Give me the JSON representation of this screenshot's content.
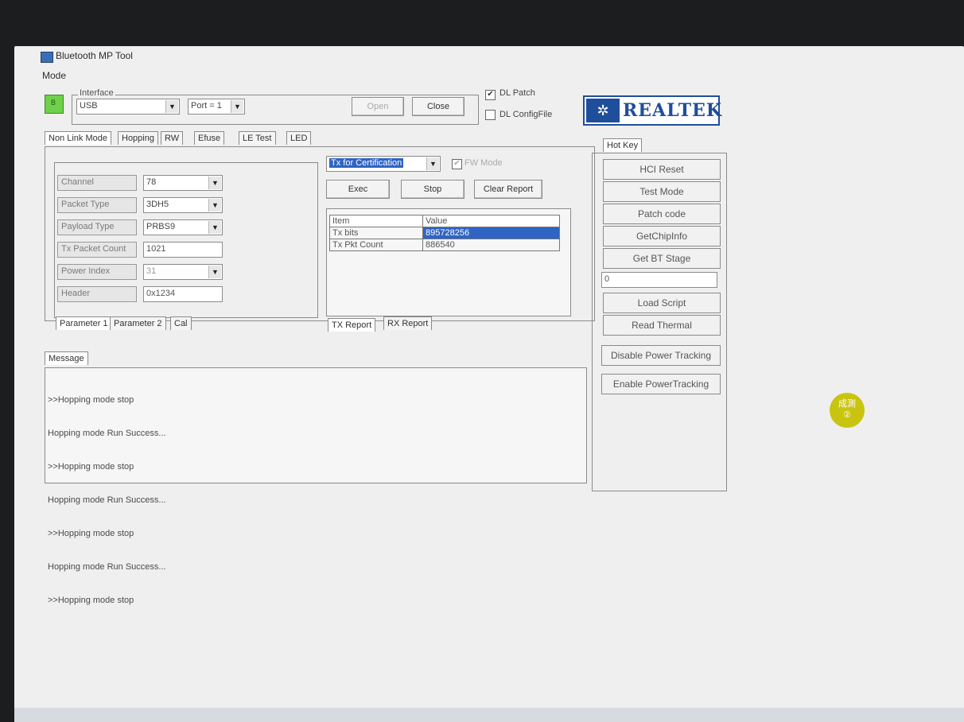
{
  "window": {
    "title": "Bluetooth MP Tool",
    "menu": [
      "Mode"
    ]
  },
  "interface": {
    "group_label": "Interface",
    "led_label": "B",
    "type_value": "USB",
    "port_value": "Port = 1",
    "open_label": "Open",
    "close_label": "Close",
    "dl_patch_label": "DL Patch",
    "dl_patch_checked": true,
    "dl_configfile_label": "DL ConfigFile",
    "dl_configfile_checked": false
  },
  "logo": {
    "text": "REALTEK"
  },
  "tabs": [
    "Non Link Mode",
    "Hopping",
    "RW",
    "Efuse",
    "LE Test",
    "LED"
  ],
  "params": {
    "channel_label": "Channel",
    "channel_value": "78",
    "packet_type_label": "Packet Type",
    "packet_type_value": "3DH5",
    "payload_type_label": "Payload Type",
    "payload_type_value": "PRBS9",
    "tx_packet_count_label": "Tx Packet Count",
    "tx_packet_count_value": "1021",
    "power_index_label": "Power Index",
    "power_index_value": "31",
    "header_label": "Header",
    "header_value": "0x1234"
  },
  "param_tabs": [
    "Parameter 1",
    "Parameter 2",
    "Cal"
  ],
  "test": {
    "mode_value": "Tx for Certification",
    "fw_mode_label": "FW Mode",
    "exec_label": "Exec",
    "stop_label": "Stop",
    "clear_report_label": "Clear Report",
    "report_columns": [
      "Item",
      "Value"
    ],
    "report_rows": [
      {
        "item": "Tx bits",
        "value": "895728256"
      },
      {
        "item": "Tx Pkt Count",
        "value": "886540"
      }
    ],
    "report_tabs": [
      "TX Report",
      "RX Report"
    ]
  },
  "hotkey": {
    "tab_label": "Hot Key",
    "buttons": [
      "HCI Reset",
      "Test Mode",
      "Patch code",
      "GetChipInfo",
      "Get BT Stage"
    ],
    "stage_value": "0",
    "buttons2": [
      "Load Script",
      "Read Thermal",
      "Disable Power Tracking",
      "Enable PowerTracking"
    ]
  },
  "message": {
    "tab_label": "Message",
    "lines": [
      ">>Hopping mode stop",
      "Hopping mode Run Success...",
      ">>Hopping mode stop",
      "Hopping mode Run Success...",
      ">>Hopping mode stop",
      "Hopping mode Run Success...",
      ">>Hopping mode stop"
    ]
  },
  "sticker": {
    "line1": "成測",
    "line2": "②"
  },
  "colors": {
    "selection": "#2f64c4",
    "led": "#6fd14b",
    "brand": "#1f4e9c"
  }
}
